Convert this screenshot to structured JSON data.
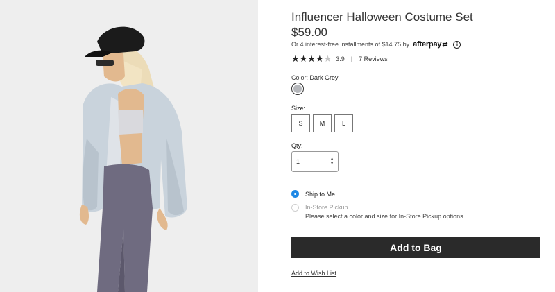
{
  "product": {
    "title": "Influencer Halloween Costume Set",
    "price": "$59.00",
    "image_alt": "Model wearing grey fuzzy jacket, crop top, leggings and black cap"
  },
  "afterpay": {
    "text": "Or 4 interest-free installments of $14.75 by",
    "logo": "afterpay",
    "info_icon": "ⓘ"
  },
  "rating": {
    "stars": 3.9,
    "score": "3.9",
    "separator": "|",
    "reviews": "7 Reviews"
  },
  "color": {
    "label": "Color:",
    "value": "Dark Grey",
    "swatch_hex": "#b5b7bb"
  },
  "size": {
    "label": "Size:",
    "options": [
      "S",
      "M",
      "L"
    ]
  },
  "qty": {
    "label": "Qty:",
    "value": "1"
  },
  "shipping": {
    "ship_to_me": "Ship to Me",
    "in_store": "In-Store Pickup",
    "in_store_note": "Please select a color and size for In-Store Pickup options"
  },
  "actions": {
    "add_to_bag": "Add to Bag",
    "wishlist": "Add to Wish List"
  },
  "colors": {
    "accent": "#1e88e5",
    "button_bg": "#2a2a2a"
  }
}
